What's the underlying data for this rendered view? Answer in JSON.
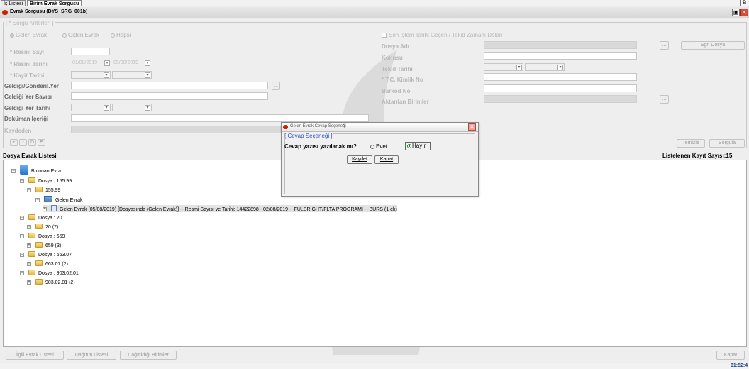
{
  "tabs": [
    "İş Listesi",
    "Birim Evrak Sorgusu"
  ],
  "window": {
    "title": "Evrak Sorgusu (DYS_SRG_001b)",
    "close_glyph": "✕"
  },
  "criteria": {
    "group_title": "[ * Sorgu Kriterleri ]",
    "radio_gelen": "Gelen Evrak",
    "radio_giden": "Giden Evrak",
    "radio_hepsi": "Hepsi",
    "son_islem": "Son İşlem Tarihi Geçen / Tekid Zamanı Dolan",
    "resmi_sayi": "* Resmi Sayi",
    "resmi_tarihi": "* Resmi Tarihi",
    "date_from": "01/08/2019",
    "date_to": "05/08/2019",
    "kayit_tarihi": "* Kayit Tarihi",
    "geldigi_gonderil": "Geldiği/Gönderil.Yer",
    "geldigi_yer_sayisi": "Geldiği Yer Sayısı",
    "geldigi_yer_tarihi": "Geldiği Yer Tarihi",
    "dokuman_icerigi": "Doküman İçeriği",
    "kaydeden": "Kaydeden",
    "dosya_adi": "Dosya Adı",
    "konusu": "Konusu",
    "tekid_tarihi": "Tekid Tarihi",
    "tc_kimlik": "* T.C. Kimlik No",
    "barkod_no": "Barkod No",
    "aktarilan_birimler": "Aktarılan Birimler",
    "sgn_dosya": "Sgn Dosya",
    "dots": "...",
    "icon_btns": [
      "+",
      "-",
      "D",
      "E"
    ],
    "temizle": "Temizle",
    "sorgula": "Sorgula"
  },
  "list": {
    "title": "Dosya Evrak Listesi",
    "count_label": "Listelenen Kayıt Sayısı:15",
    "root": "Bulunan Evra...",
    "nodes": [
      "Dosya : 155.99",
      "155.99",
      "Gelen Evrak",
      "Gelen Evrak (05/08/2019) [Dosyasında (Gelen Evrak)] -- Resmi Sayısı ve Tarihi: 14422898 - 02/08/2019 -- FULBRIGHT/FLTA PROGRAMI -- BURS (1 ek)",
      "Dosya : 20",
      "20 (7)",
      "Dosya : 659",
      "659 (3)",
      "Dosya : 663.07",
      "663.07 (2)",
      "Dosya : 903.02.01",
      "903.02.01 (2)"
    ]
  },
  "dialog": {
    "title": "Gelen Evrak Cevap Seçeneği",
    "group": "[ Cevap Seçeneği ]",
    "question": "Cevap yazısı yazılacak mı?",
    "opt_evet": "Evet",
    "opt_hayir": "Hayır",
    "kaydet": "Kaydet",
    "kapat": "Kapat"
  },
  "bottom": {
    "ilgili": "İlgili Evrak Listesi",
    "dagitim": "Dağıtım Listesi",
    "dagitildigi": "Dağıtıldığı Birimler",
    "kapat": "Kapat",
    "time": "01:52:4"
  }
}
